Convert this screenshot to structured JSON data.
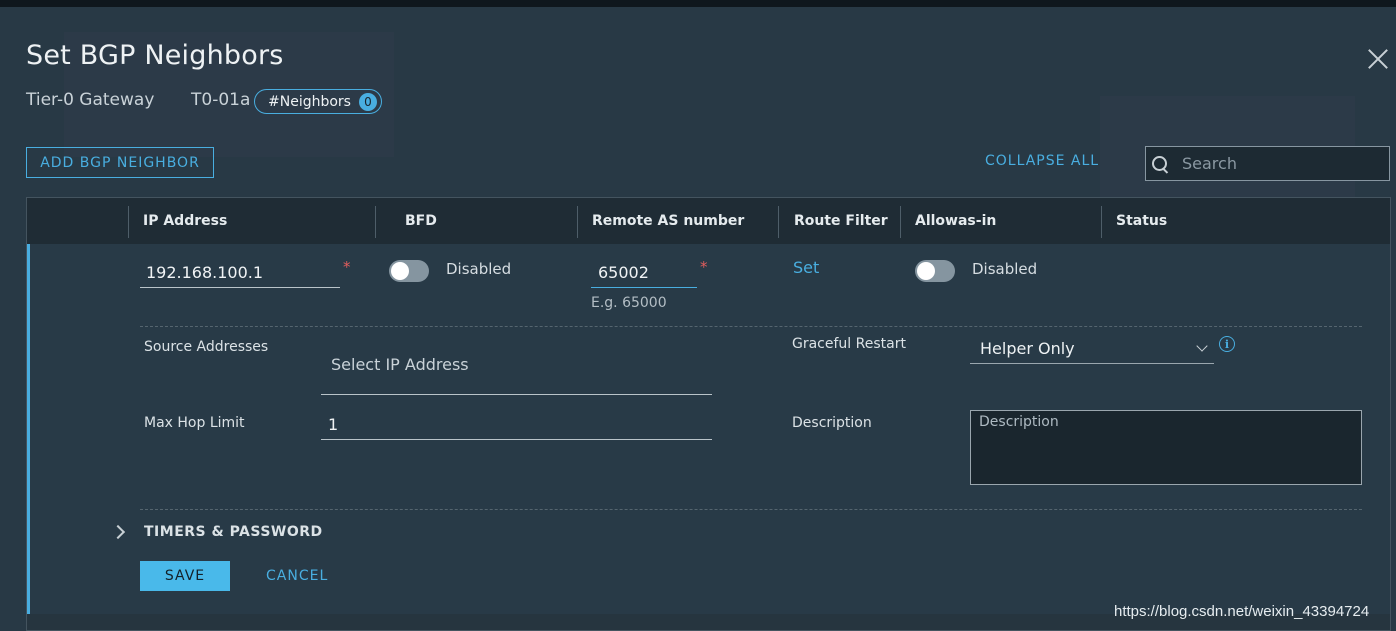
{
  "dialog": {
    "title": "Set BGP Neighbors",
    "gateway_label": "Tier-0 Gateway",
    "gateway_name": "T0-01a",
    "neighbors_badge": {
      "label": "#Neighbors",
      "count": "0"
    }
  },
  "toolbar": {
    "add_label": "ADD BGP NEIGHBOR",
    "collapse_label": "COLLAPSE ALL",
    "search_placeholder": "Search"
  },
  "table": {
    "columns": [
      "IP Address",
      "BFD",
      "Remote AS number",
      "Route Filter",
      "Allowas-in",
      "Status"
    ]
  },
  "row": {
    "ip_address": "192.168.100.1",
    "required_mark": "*",
    "bfd_state": "Disabled",
    "remote_as": "65002",
    "remote_as_hint": "E.g. 65000",
    "route_filter_link": "Set",
    "allowas_state": "Disabled",
    "source_addresses_label": "Source Addresses",
    "source_addresses_placeholder": "Select IP Address",
    "max_hop_label": "Max Hop Limit",
    "max_hop_value": "1",
    "graceful_restart_label": "Graceful Restart",
    "graceful_restart_value": "Helper Only",
    "description_label": "Description",
    "description_placeholder": "Description",
    "timers_label": "TIMERS & PASSWORD",
    "save_label": "SAVE",
    "cancel_label": "CANCEL"
  },
  "watermark": "https://blog.csdn.net/weixin_43394724",
  "colors": {
    "accent": "#49aee0",
    "background": "#283945",
    "required": "#e25d5d"
  }
}
